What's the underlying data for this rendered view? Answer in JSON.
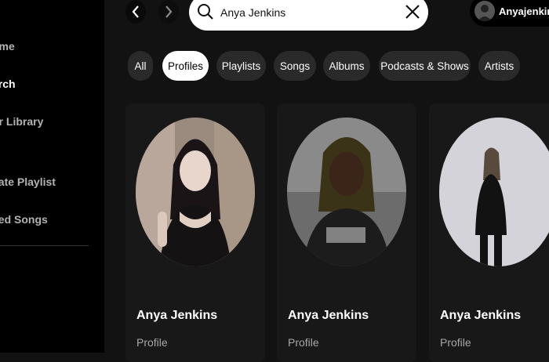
{
  "sidebar": {
    "items": [
      {
        "label": "ome"
      },
      {
        "label": "arch"
      },
      {
        "label": "ur Library"
      },
      {
        "label": "eate Playlist"
      },
      {
        "label": "ked Songs"
      }
    ]
  },
  "search": {
    "query": "Anya Jenkins"
  },
  "user": {
    "name": "Anyajenkins"
  },
  "filters": [
    {
      "label": "All"
    },
    {
      "label": "Profiles"
    },
    {
      "label": "Playlists"
    },
    {
      "label": "Songs"
    },
    {
      "label": "Albums"
    },
    {
      "label": "Podcasts & Shows"
    },
    {
      "label": "Artists"
    }
  ],
  "results": [
    {
      "name": "Anya Jenkins",
      "type": "Profile"
    },
    {
      "name": "Anya Jenkins",
      "type": "Profile"
    },
    {
      "name": "Anya Jenkins",
      "type": "Profile"
    }
  ],
  "colors": {
    "background": "#121212",
    "sidebar": "#000000",
    "card": "#181818",
    "chip": "#2a2a2a",
    "active_chip": "#ffffff"
  }
}
